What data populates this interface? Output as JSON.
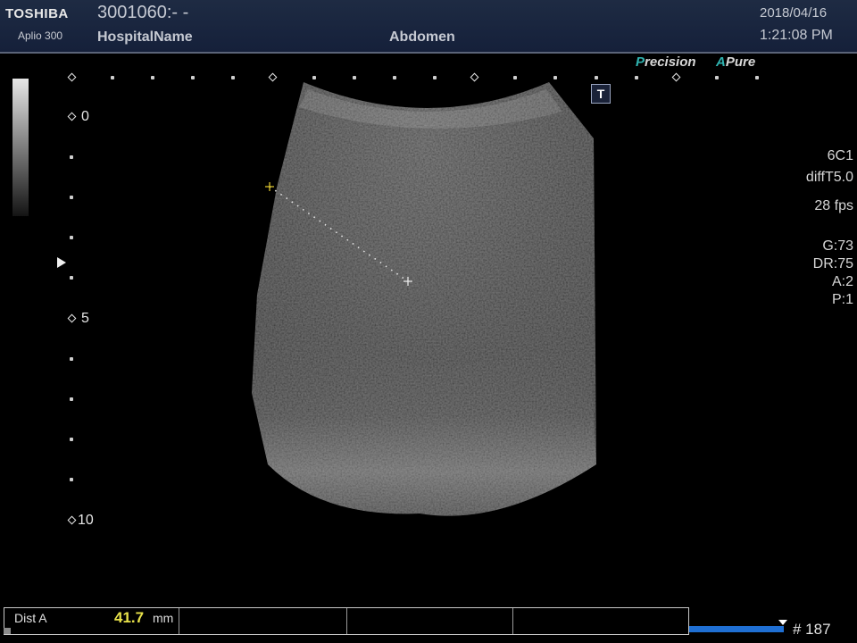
{
  "header": {
    "brand": "TOSHIBA",
    "model": "Aplio 300",
    "patient_id": "3001060:- -",
    "hospital": "HospitalName",
    "exam": "Abdomen",
    "date": "2018/04/16",
    "time": "1:21:08 PM"
  },
  "logos": {
    "precision_a": "P",
    "precision_b": "recision",
    "apure_a": "A",
    "apure_b": "Pure"
  },
  "t_icon": "T",
  "depth_scale": {
    "labels": [
      "0",
      "5",
      "10"
    ]
  },
  "params": {
    "probe": "6C1",
    "preset": "diffT5.0",
    "fps": "28 fps",
    "gain": "G:73",
    "dynamic_range": "DR:75",
    "a": "A:2",
    "p": "P:1"
  },
  "measurement": {
    "label": "Dist A",
    "value": "41.7",
    "unit": "mm"
  },
  "cine": {
    "frame": "# 187"
  },
  "colors": {
    "accent": "#2fb3b0",
    "measure_value": "#e8e24a",
    "caliper_start": "#e8d030",
    "cine_bar": "#1f6fd3"
  }
}
